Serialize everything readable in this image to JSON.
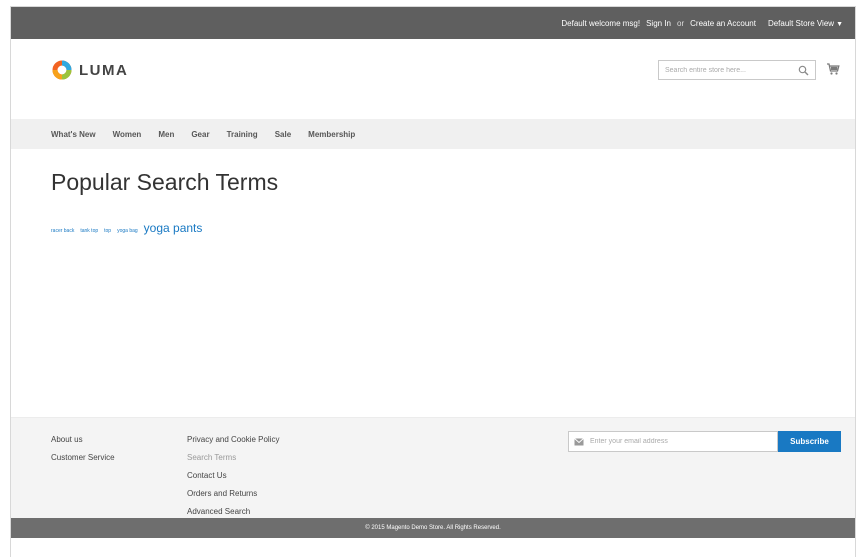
{
  "header_top": {
    "welcome": "Default welcome msg!",
    "sign_in": "Sign In",
    "or": "or",
    "create_account": "Create an Account",
    "store_view": "Default Store View"
  },
  "brand": {
    "name": "LUMA"
  },
  "search": {
    "placeholder": "Search entire store here..."
  },
  "nav": {
    "items": [
      "What's New",
      "Women",
      "Men",
      "Gear",
      "Training",
      "Sale",
      "Membership"
    ]
  },
  "main": {
    "title": "Popular Search Terms",
    "terms": [
      "racer back",
      "tank top",
      "top",
      "yoga bag",
      "yoga pants"
    ]
  },
  "footer": {
    "col1": [
      "About us",
      "Customer Service"
    ],
    "col2": [
      "Privacy and Cookie Policy",
      "Search Terms",
      "Contact Us",
      "Orders and Returns",
      "Advanced Search"
    ],
    "newsletter_placeholder": "Enter your email address",
    "subscribe_label": "Subscribe",
    "copyright": "© 2015 Magento Demo Store. All Rights Reserved."
  },
  "colors": {
    "accent": "#1979c3",
    "topbar": "#5f5f5f",
    "nav_bg": "#f0f0f0",
    "footer_bg": "#f4f4f4"
  }
}
